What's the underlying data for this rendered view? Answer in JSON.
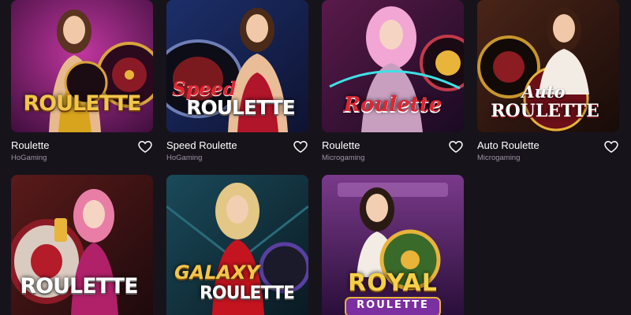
{
  "games": [
    {
      "title": "Roulette",
      "provider": "HoGaming",
      "logo": {
        "main": "ROULETTE",
        "sub": ""
      }
    },
    {
      "title": "Speed Roulette",
      "provider": "HoGaming",
      "logo": {
        "main": "ROULETTE",
        "sub": "Speed"
      }
    },
    {
      "title": "Roulette",
      "provider": "Microgaming",
      "logo": {
        "main": "Roulette",
        "sub": ""
      }
    },
    {
      "title": "Auto Roulette",
      "provider": "Microgaming",
      "logo": {
        "main": "ROULETTE",
        "sub": "Auto"
      }
    },
    {
      "title": "",
      "provider": "",
      "logo": {
        "main": "ROULETTE",
        "sub": ""
      }
    },
    {
      "title": "",
      "provider": "",
      "logo": {
        "main": "ROULETTE",
        "sub": "GALAXY"
      }
    },
    {
      "title": "",
      "provider": "",
      "logo": {
        "main": "ROULETTE",
        "sub": "ROYAL"
      }
    }
  ],
  "icons": {
    "favorite": "heart-outline-icon",
    "wheel": "roulette-wheel-icon"
  },
  "colors": {
    "background": "#17131b",
    "title": "#ffffff",
    "provider": "#9a94a4",
    "gold": "#e8b43a",
    "red": "#c41e28",
    "purple": "#6a2d8f"
  }
}
